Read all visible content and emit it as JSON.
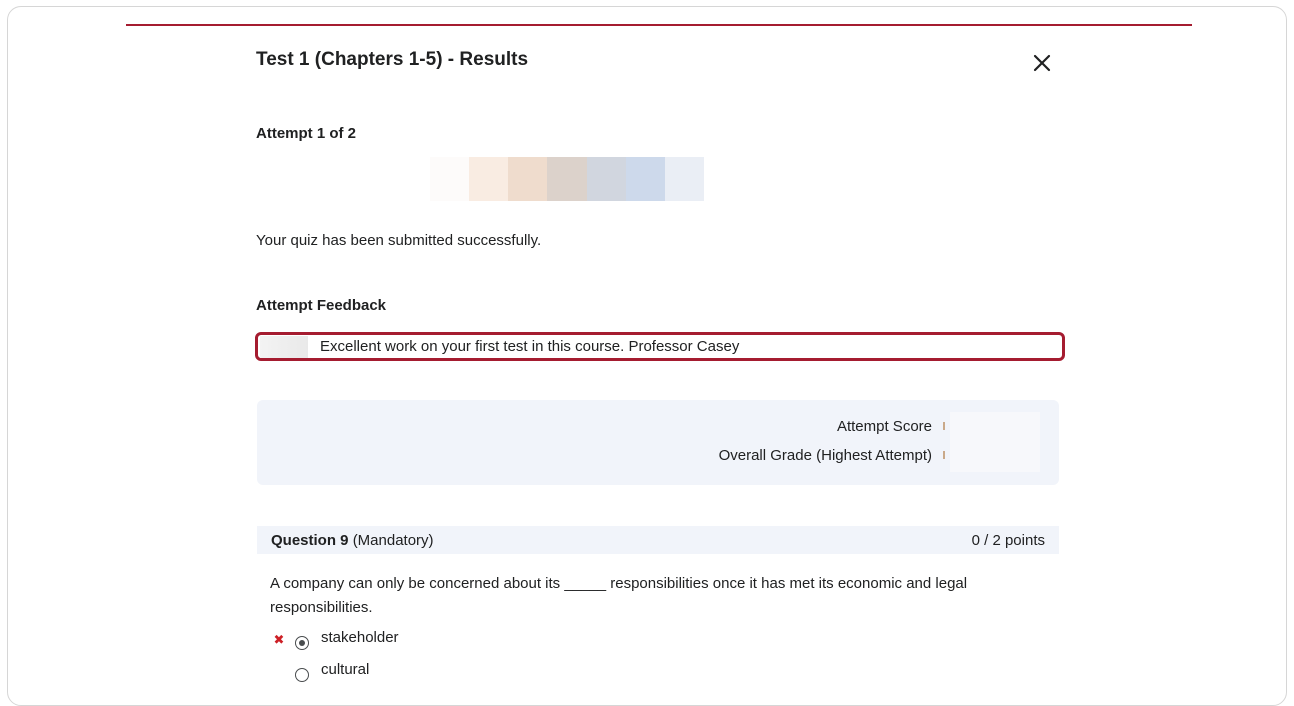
{
  "dialog": {
    "title": "Test 1 (Chapters 1-5) - Results",
    "close_icon": "close-icon"
  },
  "attempt": {
    "label": "Attempt 1 of 2"
  },
  "status": {
    "message": "Your quiz has been submitted successfully."
  },
  "feedback": {
    "heading": "Attempt Feedback",
    "text": "Excellent work on your first test in this course.  Professor Casey"
  },
  "scores": {
    "attempt_score_label": "Attempt Score",
    "overall_grade_label": "Overall Grade (Highest Attempt)"
  },
  "question": {
    "name": "Question 9",
    "qualifier": "(Mandatory)",
    "points": "0 / 2 points",
    "text": "A company can only be concerned about its _____ responsibilities once it has met its economic and legal responsibilities.",
    "options": [
      {
        "label": "stakeholder",
        "selected": true,
        "marked_incorrect": true
      },
      {
        "label": "cultural",
        "selected": false,
        "marked_incorrect": false
      }
    ]
  },
  "colors": {
    "accent": "#a51c30",
    "incorrect": "#cd2026",
    "panel_bg": "#f1f4fa"
  }
}
